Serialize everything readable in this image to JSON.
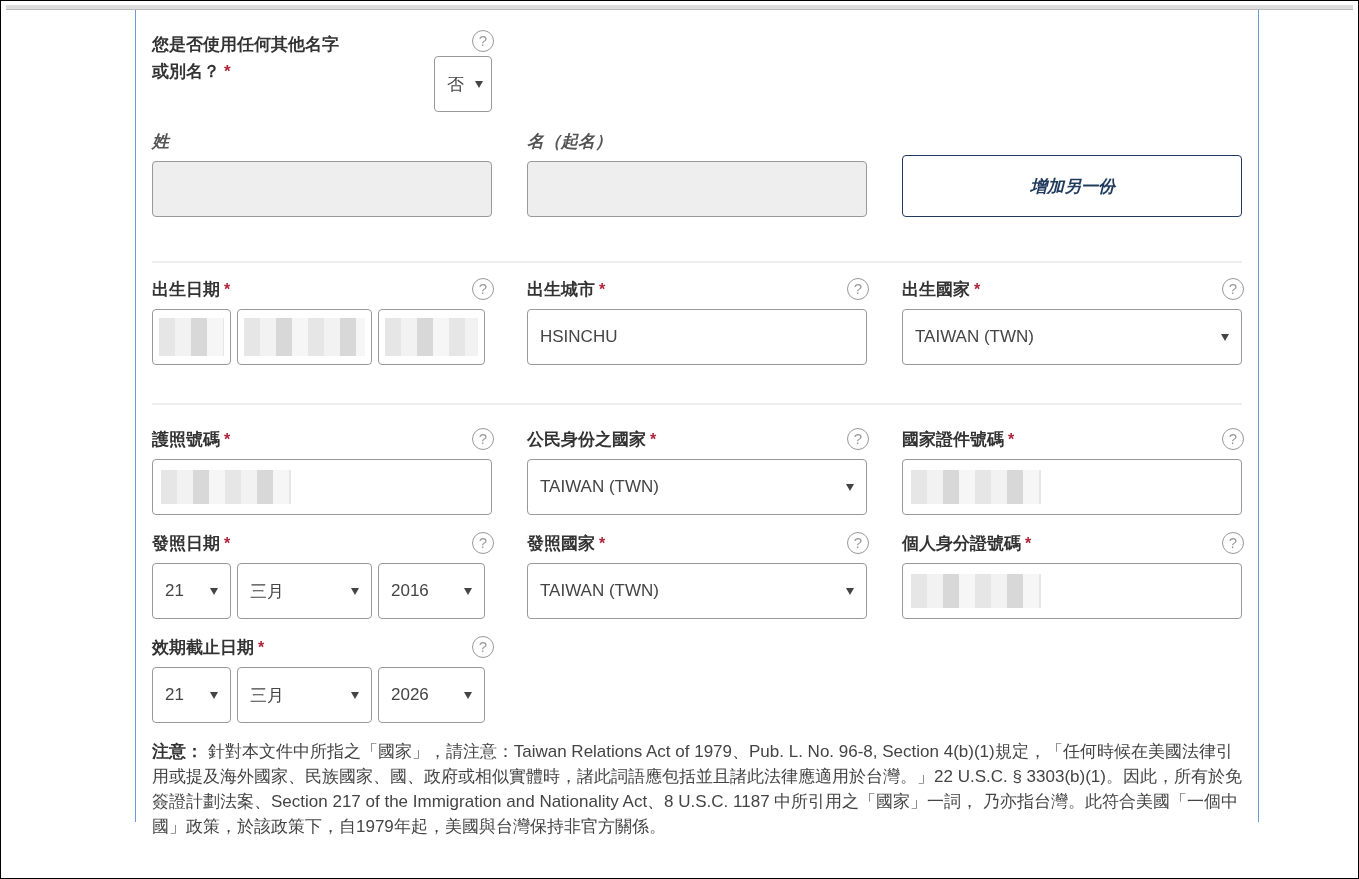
{
  "alias_question": {
    "label": "您是否使用任何其他名字或別名？",
    "required_mark": "*",
    "help": "?",
    "value": "否"
  },
  "alias_fields": [
    {
      "label": "姓",
      "disabled": true
    },
    {
      "label": "名（起名）",
      "disabled": true
    }
  ],
  "add_button": "增加另一份",
  "sections": [
    [
      [
        {
          "kind": "date",
          "label": "出生日期",
          "required_mark": "*",
          "help": "?",
          "parts": [
            {
              "redacted": true
            },
            {
              "redacted": true
            },
            {
              "redacted": true
            }
          ]
        },
        {
          "kind": "text",
          "label": "出生城市",
          "required_mark": "*",
          "help": "?",
          "value": "HSINCHU"
        },
        {
          "kind": "select",
          "label": "出生國家",
          "required_mark": "*",
          "help": "?",
          "value": "TAIWAN (TWN)"
        }
      ]
    ],
    [
      [
        {
          "kind": "text",
          "label": "護照號碼",
          "required_mark": "*",
          "help": "?",
          "redacted": true
        },
        {
          "kind": "select",
          "label": "公民身份之國家",
          "required_mark": "*",
          "help": "?",
          "value": "TAIWAN (TWN)"
        },
        {
          "kind": "text",
          "label": "國家證件號碼",
          "required_mark": "*",
          "help": "?",
          "redacted": true
        }
      ],
      [
        {
          "kind": "date",
          "label": "發照日期",
          "required_mark": "*",
          "help": "?",
          "parts": [
            {
              "value": "21"
            },
            {
              "value": "三月"
            },
            {
              "value": "2016"
            }
          ]
        },
        {
          "kind": "select",
          "label": "發照國家",
          "required_mark": "*",
          "help": "?",
          "value": "TAIWAN (TWN)"
        },
        {
          "kind": "text",
          "label": "個人身分證號碼",
          "required_mark": "*",
          "help": "?",
          "redacted": true
        }
      ],
      [
        {
          "kind": "date",
          "label": "效期截止日期",
          "required_mark": "*",
          "help": "?",
          "parts": [
            {
              "value": "21"
            },
            {
              "value": "三月"
            },
            {
              "value": "2026"
            }
          ]
        }
      ]
    ]
  ],
  "note": "**注意：** 針對本文件中所指之「國家」，請注意：Taiwan Relations Act of 1979、Pub. L. No. 96-8, Section 4(b)(1)規定，「任何時候在美國法律引用或提及海外國家、民族國家、國、政府或相似實體時，諸此詞語應包括並且諸此法律應適用於台灣。」22 U.S.C. § 3303(b)(1)。因此，所有於免簽證計劃法案、Section 217 of the Immigration and Nationality Act、8 U.S.C. 1187 中所引用之「國家」一詞， 乃亦指台灣。此符合美國「一個中國」政策，於該政策下，自1979年起，美國與台灣保持非官方關係。"
}
